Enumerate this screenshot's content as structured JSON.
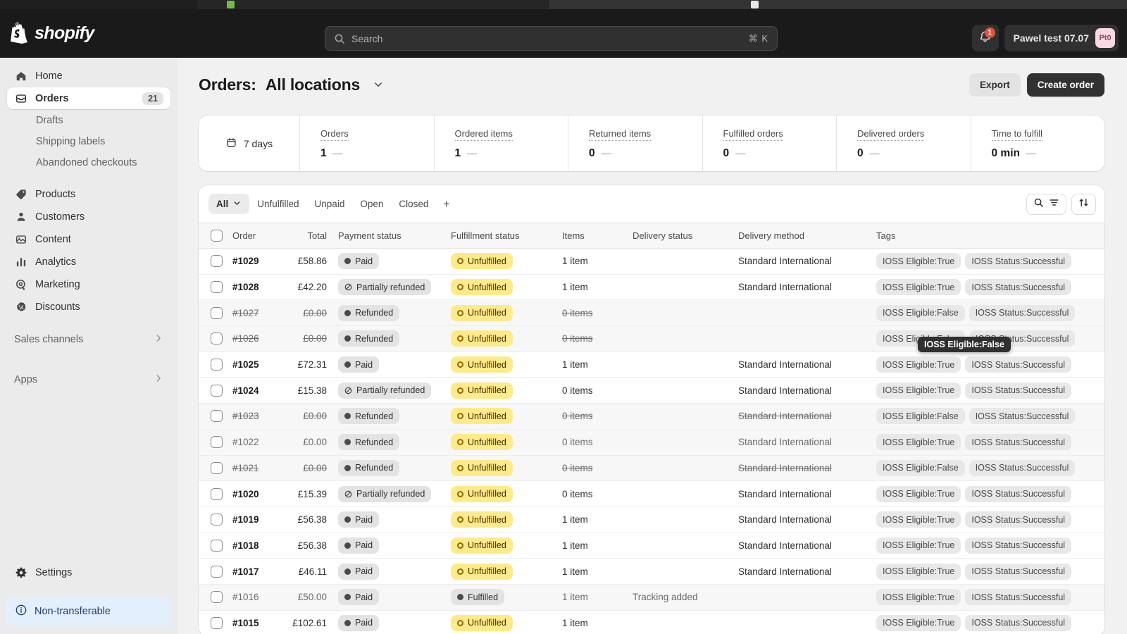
{
  "topbar": {
    "brand": "shopify",
    "search": {
      "placeholder": "Search",
      "shortcut": "⌘ K",
      "icon": "search-icon"
    },
    "notifications": {
      "icon": "bell-icon",
      "count": "1"
    },
    "account": {
      "name": "Pawel test 07.07",
      "initials": "Pt0"
    }
  },
  "sidebar": {
    "items": [
      {
        "label": "Home",
        "icon": "home-icon"
      },
      {
        "label": "Orders",
        "icon": "orders-icon",
        "count": "21",
        "active": true
      },
      {
        "label": "Drafts",
        "sub": true
      },
      {
        "label": "Shipping labels",
        "sub": true
      },
      {
        "label": "Abandoned checkouts",
        "sub": true
      },
      {
        "label": "Products",
        "icon": "tag-icon"
      },
      {
        "label": "Customers",
        "icon": "person-icon"
      },
      {
        "label": "Content",
        "icon": "content-icon"
      },
      {
        "label": "Analytics",
        "icon": "analytics-icon"
      },
      {
        "label": "Marketing",
        "icon": "marketing-icon"
      },
      {
        "label": "Discounts",
        "icon": "discount-icon"
      }
    ],
    "groups": [
      {
        "label": "Sales channels",
        "icon": "chevron-right-icon"
      },
      {
        "label": "Apps",
        "icon": "chevron-right-icon"
      }
    ],
    "settings": {
      "label": "Settings",
      "icon": "gear-icon"
    },
    "banner": {
      "label": "Non-transferable",
      "icon": "info-icon"
    }
  },
  "page": {
    "title": "Orders:",
    "location": "All locations",
    "location_chevron": "chevron-down-icon",
    "export_label": "Export",
    "create_label": "Create order"
  },
  "metrics": {
    "date_range": "7 days",
    "date_icon": "calendar-icon",
    "items": [
      {
        "label": "Orders",
        "value": "1",
        "delta": "—"
      },
      {
        "label": "Ordered items",
        "value": "1",
        "delta": "—"
      },
      {
        "label": "Returned items",
        "value": "0",
        "delta": "—"
      },
      {
        "label": "Fulfilled orders",
        "value": "0",
        "delta": "—"
      },
      {
        "label": "Delivered orders",
        "value": "0",
        "delta": "—"
      },
      {
        "label": "Time to fulfill",
        "value": "0 min",
        "delta": "—"
      }
    ]
  },
  "filters": {
    "tabs": [
      {
        "label": "All",
        "active": true,
        "chevron": "chevron-down-icon"
      },
      {
        "label": "Unfulfilled"
      },
      {
        "label": "Unpaid"
      },
      {
        "label": "Open"
      },
      {
        "label": "Closed"
      }
    ],
    "add_label": "+",
    "search_icon": "search-icon",
    "filter_icon": "filter-icon",
    "sort_icon": "sort-icon"
  },
  "table": {
    "columns": [
      "Order",
      "Total",
      "Payment status",
      "Fulfillment status",
      "Items",
      "Delivery status",
      "Delivery method",
      "Tags"
    ],
    "rows": [
      {
        "order": "#1029",
        "total": "£58.86",
        "payment": "Paid",
        "payment_icon": "dot-filled",
        "fulfillment": "Unfulfilled",
        "items": "1 item",
        "delivery_status": "",
        "method": "Standard International",
        "tags": [
          "IOSS Eligible:True",
          "IOSS Status:Successful"
        ],
        "state": "normal"
      },
      {
        "order": "#1028",
        "total": "£42.20",
        "payment": "Partially refunded",
        "payment_icon": "dot-slash",
        "fulfillment": "Unfulfilled",
        "items": "1 item",
        "delivery_status": "",
        "method": "Standard International",
        "tags": [
          "IOSS Eligible:True",
          "IOSS Status:Successful"
        ],
        "state": "normal"
      },
      {
        "order": "#1027",
        "total": "£0.00",
        "payment": "Refunded",
        "payment_icon": "dot-filled",
        "fulfillment": "Unfulfilled",
        "items": "0 items",
        "delivery_status": "",
        "method": "",
        "tags": [
          "IOSS Eligible:False",
          "IOSS Status:Successful"
        ],
        "state": "cancelled"
      },
      {
        "order": "#1026",
        "total": "£0.00",
        "payment": "Refunded",
        "payment_icon": "dot-filled",
        "fulfillment": "Unfulfilled",
        "items": "0 items",
        "delivery_status": "",
        "method": "",
        "tags": [
          "IOSS Eligible:False",
          "IOSS Status:Successful"
        ],
        "state": "cancelled"
      },
      {
        "order": "#1025",
        "total": "£72.31",
        "payment": "Paid",
        "payment_icon": "dot-filled",
        "fulfillment": "Unfulfilled",
        "items": "1 item",
        "delivery_status": "",
        "method": "Standard International",
        "tags": [
          "IOSS Eligible:True",
          "IOSS Status:Successful"
        ],
        "state": "normal"
      },
      {
        "order": "#1024",
        "total": "£15.38",
        "payment": "Partially refunded",
        "payment_icon": "dot-slash",
        "fulfillment": "Unfulfilled",
        "items": "0 items",
        "delivery_status": "",
        "method": "Standard International",
        "tags": [
          "IOSS Eligible:True",
          "IOSS Status:Successful"
        ],
        "state": "normal"
      },
      {
        "order": "#1023",
        "total": "£0.00",
        "payment": "Refunded",
        "payment_icon": "dot-filled",
        "fulfillment": "Unfulfilled",
        "items": "0 items",
        "delivery_status": "",
        "method": "Standard International",
        "tags": [
          "IOSS Eligible:False",
          "IOSS Status:Successful"
        ],
        "state": "cancelled"
      },
      {
        "order": "#1022",
        "total": "£0.00",
        "payment": "Refunded",
        "payment_icon": "dot-filled",
        "fulfillment": "Unfulfilled",
        "items": "0 items",
        "delivery_status": "",
        "method": "Standard International",
        "tags": [
          "IOSS Eligible:True",
          "IOSS Status:Successful"
        ],
        "state": "read"
      },
      {
        "order": "#1021",
        "total": "£0.00",
        "payment": "Refunded",
        "payment_icon": "dot-filled",
        "fulfillment": "Unfulfilled",
        "items": "0 items",
        "delivery_status": "",
        "method": "Standard International",
        "tags": [
          "IOSS Eligible:False",
          "IOSS Status:Successful"
        ],
        "state": "cancelled"
      },
      {
        "order": "#1020",
        "total": "£15.39",
        "payment": "Partially refunded",
        "payment_icon": "dot-slash",
        "fulfillment": "Unfulfilled",
        "items": "0 items",
        "delivery_status": "",
        "method": "Standard International",
        "tags": [
          "IOSS Eligible:True",
          "IOSS Status:Successful"
        ],
        "state": "normal"
      },
      {
        "order": "#1019",
        "total": "£56.38",
        "payment": "Paid",
        "payment_icon": "dot-filled",
        "fulfillment": "Unfulfilled",
        "items": "1 item",
        "delivery_status": "",
        "method": "Standard International",
        "tags": [
          "IOSS Eligible:True",
          "IOSS Status:Successful"
        ],
        "state": "normal"
      },
      {
        "order": "#1018",
        "total": "£56.38",
        "payment": "Paid",
        "payment_icon": "dot-filled",
        "fulfillment": "Unfulfilled",
        "items": "1 item",
        "delivery_status": "",
        "method": "Standard International",
        "tags": [
          "IOSS Eligible:True",
          "IOSS Status:Successful"
        ],
        "state": "normal"
      },
      {
        "order": "#1017",
        "total": "£46.11",
        "payment": "Paid",
        "payment_icon": "dot-filled",
        "fulfillment": "Unfulfilled",
        "items": "1 item",
        "delivery_status": "",
        "method": "Standard International",
        "tags": [
          "IOSS Eligible:True",
          "IOSS Status:Successful"
        ],
        "state": "normal"
      },
      {
        "order": "#1016",
        "total": "£50.00",
        "payment": "Paid",
        "payment_icon": "dot-filled",
        "fulfillment": "Fulfilled",
        "items": "1 item",
        "delivery_status": "Tracking added",
        "method": "",
        "tags": [
          "IOSS Eligible:True",
          "IOSS Status:Successful"
        ],
        "state": "read"
      },
      {
        "order": "#1015",
        "total": "£102.61",
        "payment": "Paid",
        "payment_icon": "dot-filled",
        "fulfillment": "Unfulfilled",
        "items": "1 item",
        "delivery_status": "",
        "method": "",
        "tags": [
          "IOSS Eligible:True",
          "IOSS Status:Successful"
        ],
        "state": "normal"
      }
    ]
  },
  "tooltip": {
    "text": "IOSS Eligible:False"
  },
  "colors": {
    "topbar_bg": "#1a1a1a",
    "sidebar_bg": "#ebebeb",
    "accent_yellow": "#ffea8a",
    "badge_red": "#e0533d",
    "avatar_pink": "#fbd9e4",
    "banner_blue": "#e3effc"
  }
}
